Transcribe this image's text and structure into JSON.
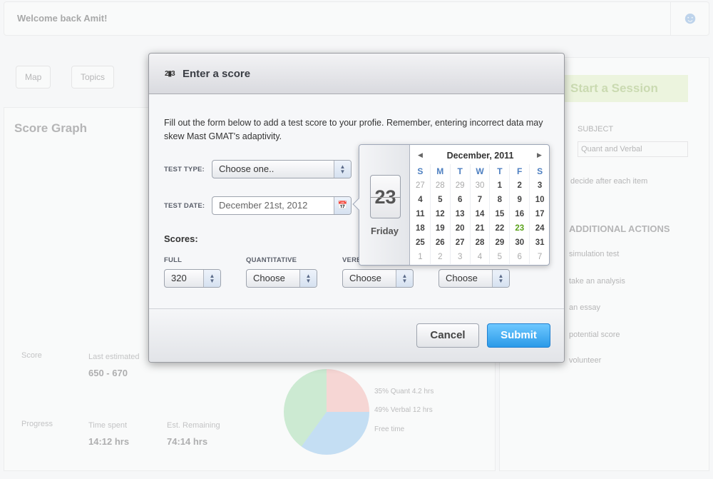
{
  "background": {
    "welcome": "Welcome back Amit!",
    "tabs": [
      "Map",
      "Topics"
    ],
    "score_graph_title": "Score Graph",
    "start_session": "Start a Session",
    "subject_label": "SUBJECT",
    "subject_value": "Quant and Verbal",
    "option_text": "decide after each item",
    "additional_actions": "ADDITIONAL ACTIONS",
    "actions": [
      "simulation test",
      "take an analysis",
      "an essay",
      "potential score",
      "volunteer"
    ],
    "stats": [
      {
        "label": "Last estimated",
        "value": "650 - 670"
      },
      {
        "label": "Time spent",
        "value": "14:12 hrs"
      },
      {
        "label": "Est. Remaining",
        "value": "74:14 hrs"
      }
    ],
    "mini_charts": [
      "Score",
      "Progress"
    ],
    "pie_legend": [
      "35% Quant 4.2 hrs",
      "49% Verbal 12 hrs",
      "Free time"
    ]
  },
  "modal": {
    "icon": "podium-icon",
    "title": "Enter a score",
    "intro": "Fill out the form below to add a test score to your profie. Remember, entering incorrect data may skew Mast GMAT's adaptivity.",
    "test_type_label": "TEST TYPE:",
    "test_type_value": "Choose one..",
    "test_date_label": "TEST DATE:",
    "test_date_value": "December 21st, 2012",
    "scores_label": "Scores:",
    "score_fields": [
      {
        "label": "FULL",
        "value": "320"
      },
      {
        "label": "QUANTITATIVE",
        "value": "Choose"
      },
      {
        "label": "VERBAL",
        "value": "Choose"
      },
      {
        "label": "",
        "value": "Choose"
      }
    ],
    "cancel": "Cancel",
    "submit": "Submit"
  },
  "calendar": {
    "selected_day": "23",
    "weekday": "Friday",
    "month": "December, 2011",
    "prev": "◀",
    "next": "▶",
    "dow": [
      "S",
      "M",
      "T",
      "W",
      "T",
      "F",
      "S"
    ],
    "weeks": [
      [
        "27",
        "28",
        "29",
        "30",
        "1",
        "2",
        "3"
      ],
      [
        "4",
        "5",
        "6",
        "7",
        "8",
        "9",
        "10"
      ],
      [
        "11",
        "12",
        "13",
        "14",
        "15",
        "16",
        "17"
      ],
      [
        "18",
        "19",
        "20",
        "21",
        "22",
        "23",
        "24"
      ],
      [
        "25",
        "26",
        "27",
        "28",
        "29",
        "30",
        "31"
      ],
      [
        "1",
        "2",
        "3",
        "4",
        "5",
        "6",
        "7"
      ]
    ],
    "selected_color": "#5aa21a"
  }
}
